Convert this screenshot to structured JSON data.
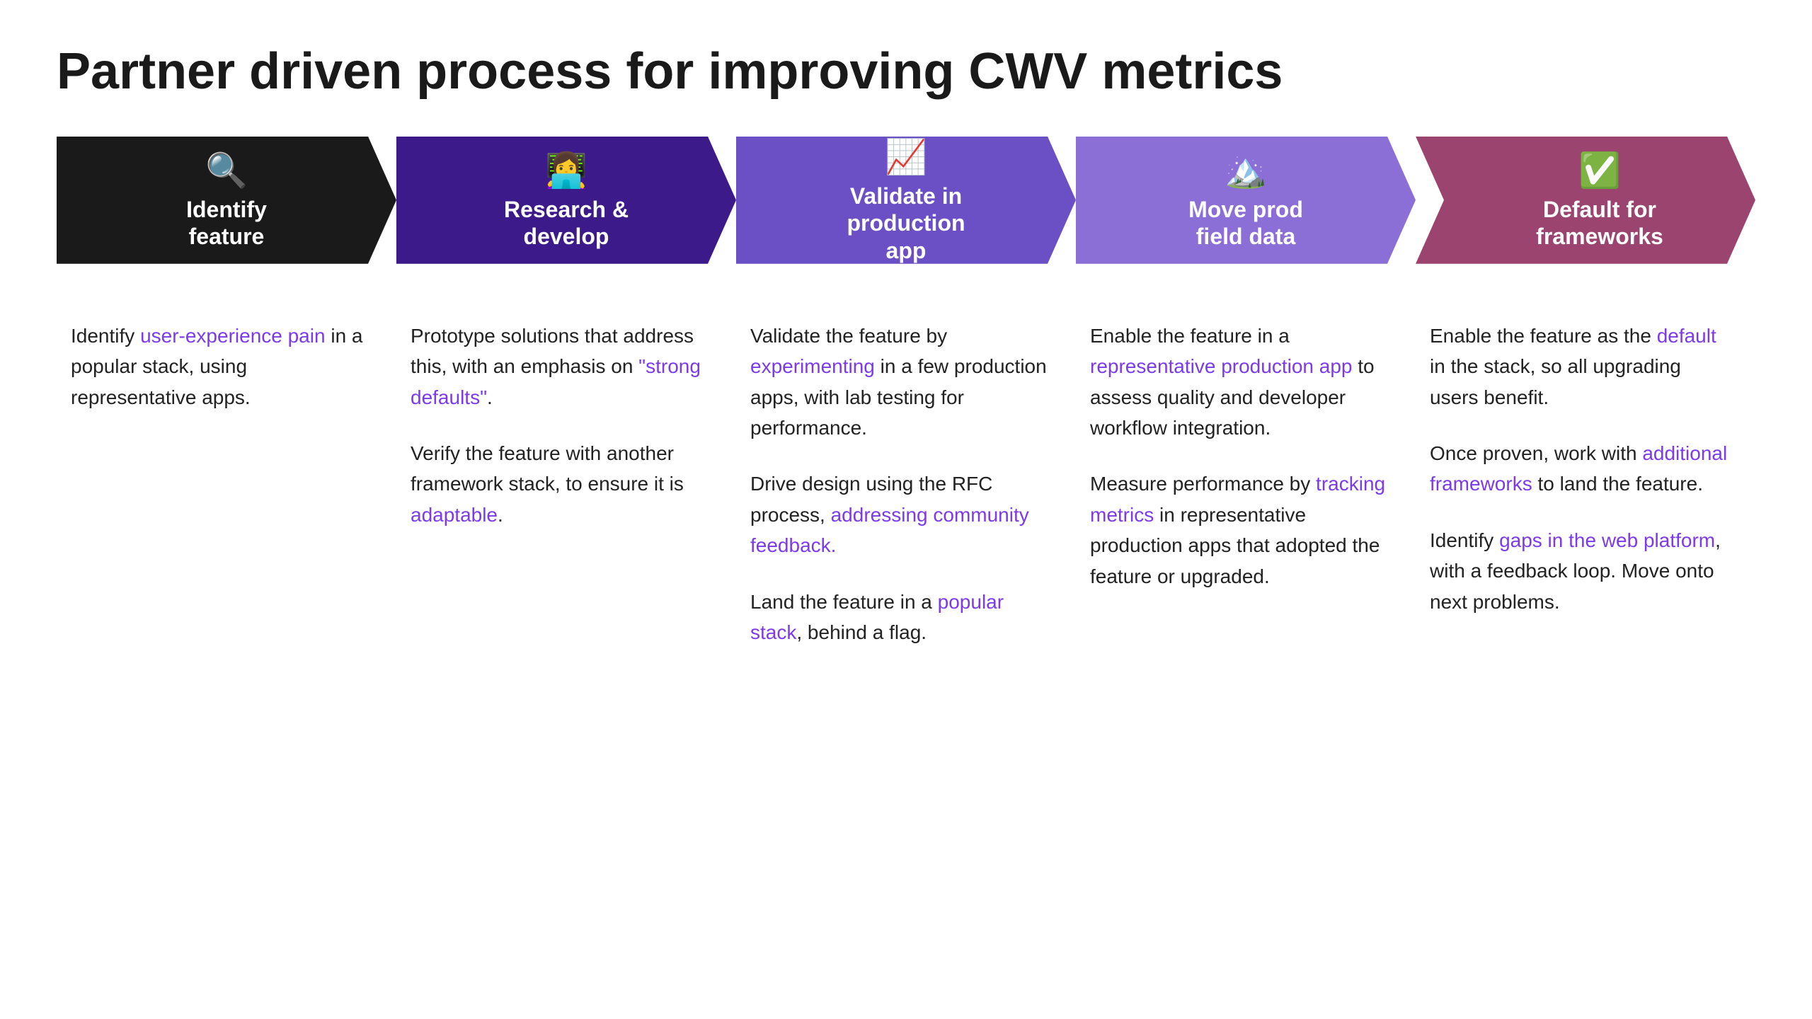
{
  "page": {
    "title": "Partner driven process for improving CWV metrics"
  },
  "arrows": [
    {
      "id": "identify",
      "color_class": "col-black",
      "icon": "🔍",
      "label": "Identify\nfeature",
      "is_first": true
    },
    {
      "id": "research",
      "color_class": "col-dark-purple",
      "icon": "👩‍💻",
      "label": "Research &\ndevelop",
      "is_first": false
    },
    {
      "id": "validate",
      "color_class": "col-mid-purple",
      "icon": "📈",
      "label": "Validate in\nproduction\napp",
      "is_first": false
    },
    {
      "id": "move",
      "color_class": "col-light-purple",
      "icon": "🏔️",
      "label": "Move prod\nfield data",
      "is_first": false
    },
    {
      "id": "default",
      "color_class": "col-rose",
      "icon": "✅",
      "label": "Default for\nframeworks",
      "is_first": false
    }
  ],
  "columns": [
    {
      "id": "identify-col",
      "paragraphs": [
        {
          "parts": [
            {
              "text": "Identify ",
              "type": "plain"
            },
            {
              "text": "user-experience pain",
              "type": "link"
            },
            {
              "text": " in a popular stack, using representative apps.",
              "type": "plain"
            }
          ]
        }
      ]
    },
    {
      "id": "research-col",
      "paragraphs": [
        {
          "parts": [
            {
              "text": "Prototype solutions that address this, with an emphasis on ",
              "type": "plain"
            },
            {
              "text": "\"strong defaults\"",
              "type": "link"
            },
            {
              "text": ".",
              "type": "plain"
            }
          ]
        },
        {
          "parts": [
            {
              "text": "Verify the feature with another framework stack, to ensure it is ",
              "type": "plain"
            },
            {
              "text": "adaptable",
              "type": "link"
            },
            {
              "text": ".",
              "type": "plain"
            }
          ]
        }
      ]
    },
    {
      "id": "validate-col",
      "paragraphs": [
        {
          "parts": [
            {
              "text": "Validate the feature by ",
              "type": "plain"
            },
            {
              "text": "experimenting",
              "type": "link"
            },
            {
              "text": " in a few production apps, with lab testing for performance.",
              "type": "plain"
            }
          ]
        },
        {
          "parts": [
            {
              "text": "Drive design using the RFC process, ",
              "type": "plain"
            },
            {
              "text": "addressing community feedback.",
              "type": "link"
            }
          ]
        },
        {
          "parts": [
            {
              "text": "Land the feature in a ",
              "type": "plain"
            },
            {
              "text": "popular stack",
              "type": "link"
            },
            {
              "text": ", behind a flag.",
              "type": "plain"
            }
          ]
        }
      ]
    },
    {
      "id": "move-col",
      "paragraphs": [
        {
          "parts": [
            {
              "text": "Enable the feature in a ",
              "type": "plain"
            },
            {
              "text": "representative production app",
              "type": "link"
            },
            {
              "text": " to assess quality and developer workflow integration.",
              "type": "plain"
            }
          ]
        },
        {
          "parts": [
            {
              "text": "Measure performance by ",
              "type": "plain"
            },
            {
              "text": "tracking metrics",
              "type": "link"
            },
            {
              "text": " in representative production apps that adopted the feature or upgraded.",
              "type": "plain"
            }
          ]
        }
      ]
    },
    {
      "id": "default-col",
      "paragraphs": [
        {
          "parts": [
            {
              "text": "Enable the feature as the ",
              "type": "plain"
            },
            {
              "text": "default",
              "type": "link"
            },
            {
              "text": " in the stack, so all upgrading users benefit.",
              "type": "plain"
            }
          ]
        },
        {
          "parts": [
            {
              "text": "Once proven, work with ",
              "type": "plain"
            },
            {
              "text": "additional frameworks",
              "type": "link"
            },
            {
              "text": " to land the feature.",
              "type": "plain"
            }
          ]
        },
        {
          "parts": [
            {
              "text": "Identify ",
              "type": "plain"
            },
            {
              "text": "gaps in the web platform",
              "type": "link"
            },
            {
              "text": ", with a feedback loop. Move onto next problems.",
              "type": "plain"
            }
          ]
        }
      ]
    }
  ]
}
